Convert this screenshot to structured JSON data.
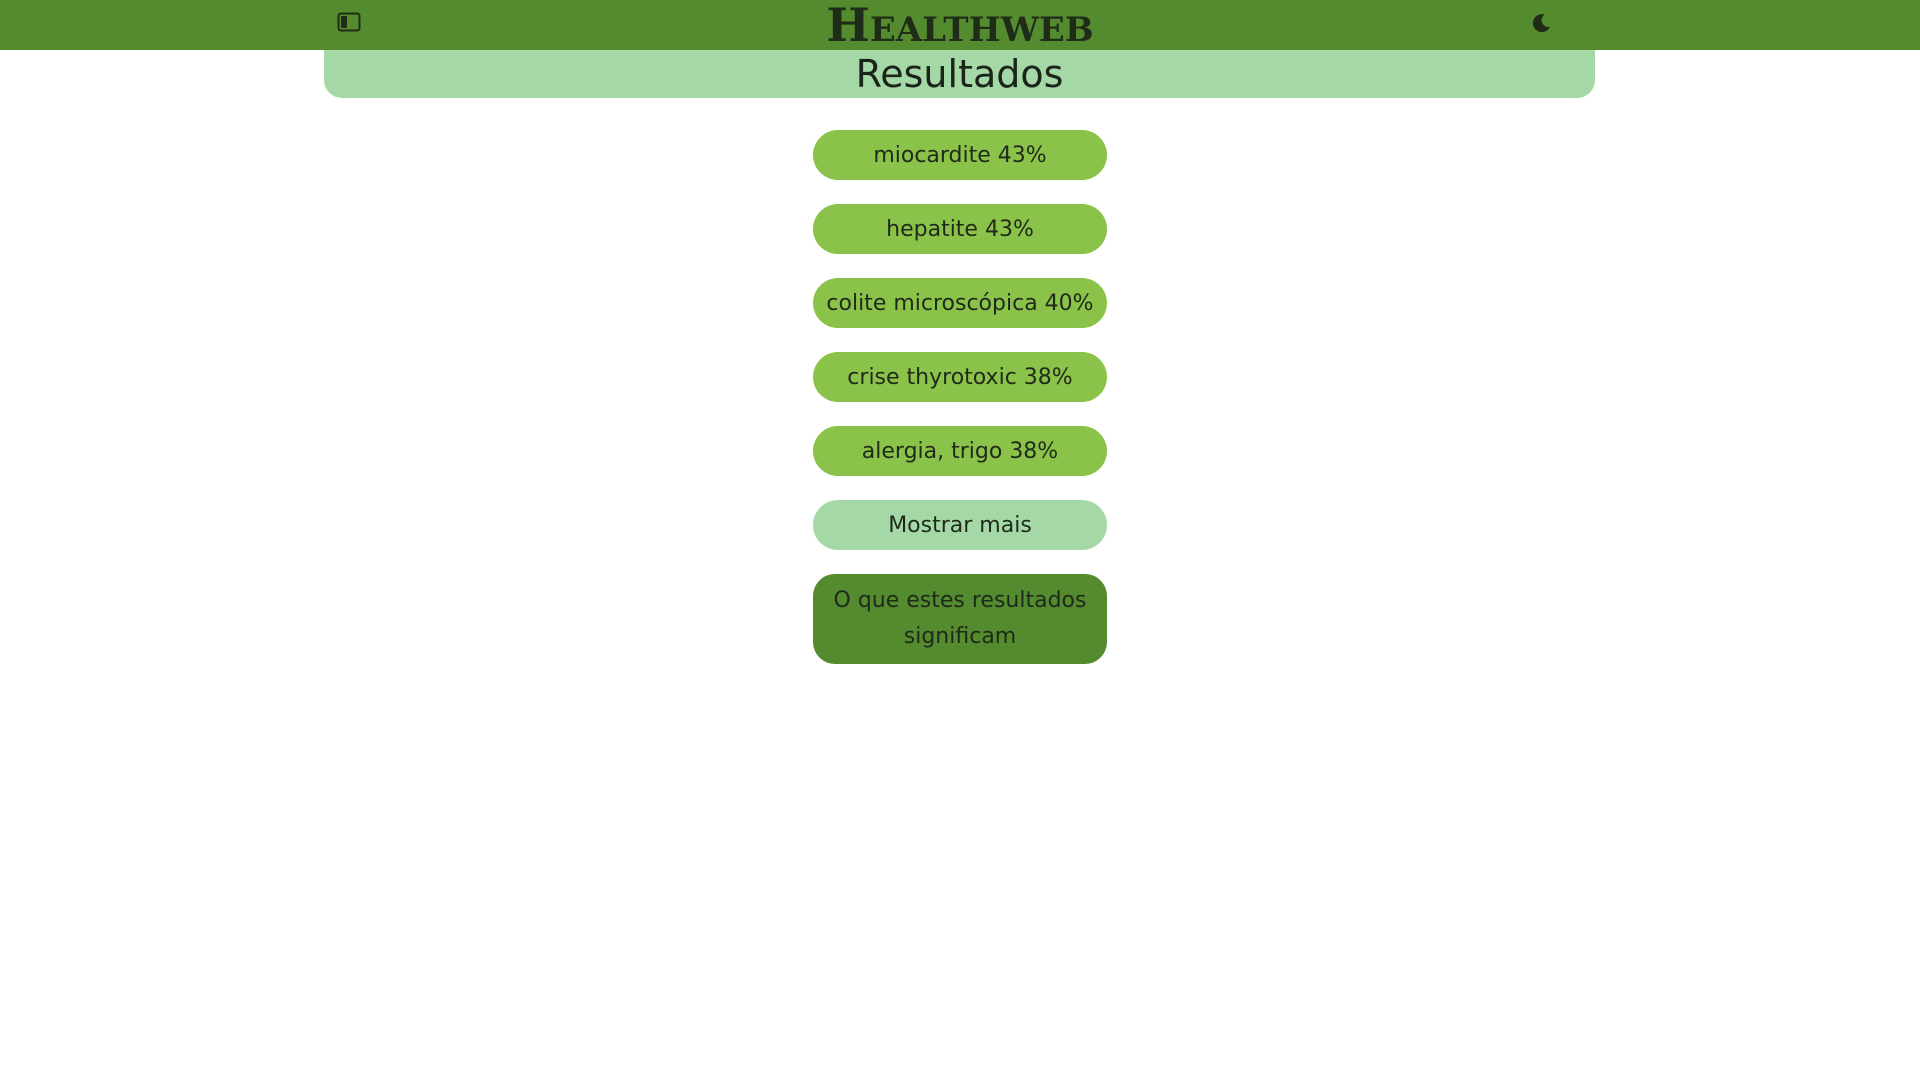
{
  "header": {
    "logo_initial": "H",
    "logo_rest": "EALTHWEB",
    "sidebar_toggle_icon": "sidebar-toggle-icon",
    "theme_toggle_icon": "moon-icon",
    "background_color": "#548b2e"
  },
  "results": {
    "title": "Resultados",
    "items": [
      {
        "label": "miocardite 43%"
      },
      {
        "label": "hepatite 43%"
      },
      {
        "label": "colite microscópica 40%"
      },
      {
        "label": "crise thyrotoxic 38%"
      },
      {
        "label": "alergia, trigo 38%"
      }
    ],
    "show_more_label": "Mostrar mais",
    "meaning_label": "O que estes resultados significam"
  },
  "colors": {
    "accent": "#548b2e",
    "pill": "#8bc24a",
    "light": "#a5d8a7"
  }
}
